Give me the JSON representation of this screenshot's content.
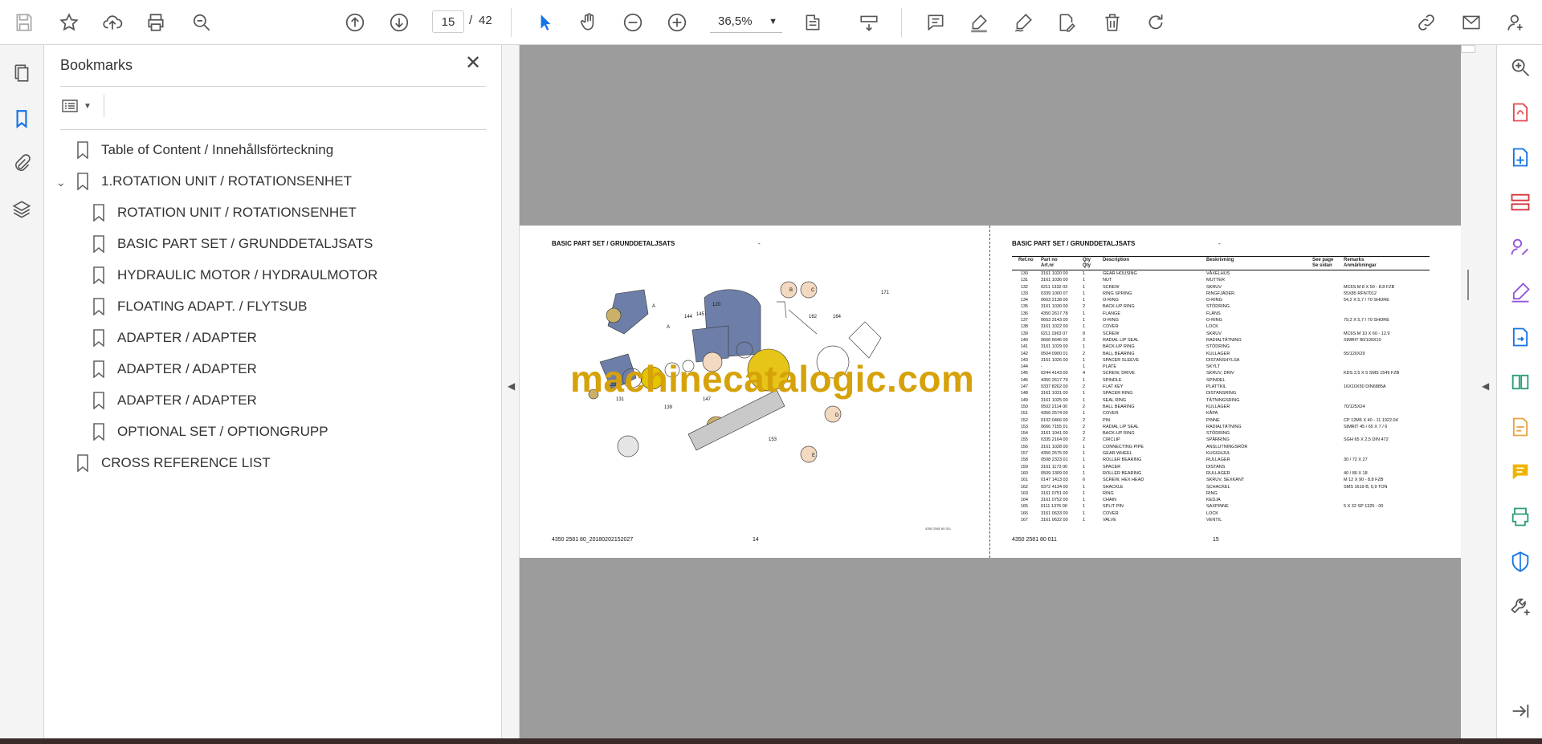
{
  "toolbar": {
    "page_current": "15",
    "page_separator": "/",
    "page_total": "42",
    "zoom": "36,5%"
  },
  "bookmarks": {
    "title": "Bookmarks",
    "items": [
      {
        "label": "Table of Content / Innehållsförteckning"
      },
      {
        "label": "1.ROTATION UNIT / ROTATIONSENHET"
      },
      {
        "label": "ROTATION UNIT / ROTATIONSENHET"
      },
      {
        "label": "BASIC PART SET / GRUNDDETALJSATS"
      },
      {
        "label": "HYDRAULIC MOTOR / HYDRAULMOTOR"
      },
      {
        "label": "FLOATING ADAPT. / FLYTSUB"
      },
      {
        "label": "ADAPTER / ADAPTER"
      },
      {
        "label": "ADAPTER / ADAPTER"
      },
      {
        "label": "ADAPTER / ADAPTER"
      },
      {
        "label": "OPTIONAL SET / OPTIONGRUPP"
      },
      {
        "label": "CROSS REFERENCE LIST"
      }
    ]
  },
  "document": {
    "left_page": {
      "header": "BASIC PART SET / GRUNDDETALJSATS",
      "header_dash": "-",
      "footer_doc": "4350 2581 80_20180202152027",
      "footer_page": "14",
      "drawing_code": "4350 2581 80 011"
    },
    "right_page": {
      "header": "BASIC PART SET / GRUNDDETALJSATS",
      "header_dash": "-",
      "footer_doc": "4350 2581 80 011",
      "footer_page": "15",
      "columns": {
        "ref": "Ref.no",
        "part": "Part no",
        "part2": "Art.nr",
        "qty": "Qty",
        "qty2": "Qty",
        "desc": "Description",
        "besk": "Beskrivning",
        "see": "See page",
        "see2": "Se sidan",
        "remarks": "Remarks",
        "remarks2": "Anmärkningar"
      },
      "rows": [
        [
          "130",
          "3161 1020 00",
          "1",
          "GEAR HOUSING",
          "VÄXELHUS",
          ""
        ],
        [
          "131",
          "3161 1036 00",
          "1",
          "NUT",
          "MUTTER",
          ""
        ],
        [
          "132",
          "0211 1332 03",
          "1",
          "SCREW",
          "SKRUV",
          "MC6S M 8 X 50 - 8.8 FZB"
        ],
        [
          "133",
          "0339 1000 07",
          "1",
          "RING SPRING",
          "RINGFJÄDER",
          "55X85 RFN7012"
        ],
        [
          "134",
          "0663 2138 00",
          "1",
          "O-RING",
          "O-RING",
          "54,2 X 5,7 / 70 SHORE"
        ],
        [
          "135",
          "3161 1030 00",
          "2",
          "BACK-UP RING",
          "STÖDRING",
          ""
        ],
        [
          "136",
          "4350 2617 78",
          "1",
          "FLANGE",
          "FLÄNS",
          ""
        ],
        [
          "137",
          "0663 3143 00",
          "1",
          "O-RING",
          "O-RING",
          "79,2 X 5,7 / 70 SHORE"
        ],
        [
          "138",
          "3161 1022 00",
          "1",
          "COVER",
          "LOCK",
          ""
        ],
        [
          "139",
          "0211 1963 07",
          "9",
          "SCREW",
          "SKRUV",
          "MC6S M 10 X 60 - 12.9"
        ],
        [
          "140",
          "0666 6646 00",
          "2",
          "RADIAL LIP SEAL",
          "RADIALTÄTNING",
          "SIMRIT 80/100X10"
        ],
        [
          "141",
          "3161 1029 00",
          "1",
          "BACK-UP RING",
          "STÖDRING",
          ""
        ],
        [
          "142",
          "0504 0900 01",
          "2",
          "BALL BEARING",
          "KULLAGER",
          "55/120X29"
        ],
        [
          "143",
          "3161 1026 00",
          "1",
          "SPACER SLEEVE",
          "DISTANSHYLSA",
          ""
        ],
        [
          "144",
          "-",
          "1",
          "PLATE",
          "SKYLT",
          ""
        ],
        [
          "145",
          "0244 4143 00",
          "4",
          "SCREW, DRIVE",
          "SKRUV, DRIV",
          "KDS 2,5 X 5 SMS 1549 FZB"
        ],
        [
          "146",
          "4350 2617 79",
          "1",
          "SPINDLE",
          "SPINDEL",
          ""
        ],
        [
          "147",
          "0337 8262 00",
          "2",
          "FLAT KEY",
          "PLATTKIL",
          "16X10X50 DIN6885A"
        ],
        [
          "148",
          "3161 1031 00",
          "1",
          "SPACER RING",
          "DISTANSRING",
          ""
        ],
        [
          "149",
          "3161 1025 00",
          "1",
          "SEAL RING",
          "TÄTNINGSRING",
          ""
        ],
        [
          "150",
          "0502 2114 00",
          "2",
          "BALL BEARING",
          "KULLAGER",
          "70/125X24"
        ],
        [
          "151",
          "4350 2574 00",
          "1",
          "COVER",
          "KÅPA",
          ""
        ],
        [
          "152",
          "0102 0466 00",
          "2",
          "PIN",
          "PINNE",
          "CP 12M6 X 40 - 11 1922.04"
        ],
        [
          "153",
          "0666 7155 01",
          "2",
          "RADIAL LIP SEAL",
          "RADIALTÄTNING",
          "SIMRIT 45 / 65 X 7 / 6"
        ],
        [
          "154",
          "3161 1041 00",
          "2",
          "BACK-UP RING",
          "STÖDRING",
          ""
        ],
        [
          "155",
          "0335 2164 00",
          "2",
          "CIRCLIP",
          "SPÅRRING",
          "SGH 65 X 2,5 DIN 472"
        ],
        [
          "156",
          "3161 1028 00",
          "1",
          "CONNECTING PIPE",
          "ANSLUTNINGSRÖR",
          ""
        ],
        [
          "157",
          "4350 2575 00",
          "1",
          "GEAR WHEEL",
          "KUGGHJUL",
          ""
        ],
        [
          "158",
          "0508 2323 01",
          "1",
          "ROLLER BEARING",
          "RULLAGER",
          "30 / 72 X 27"
        ],
        [
          "159",
          "3161 1173 00",
          "1",
          "SPACER",
          "DISTANS",
          ""
        ],
        [
          "160",
          "0509 1309 00",
          "1",
          "ROLLER BEARING",
          "RULLAGER",
          "40 / 80 X 18"
        ],
        [
          "161",
          "0147 1413 03",
          "6",
          "SCREW, HEX HEAD",
          "SKRUV, SEXKANT",
          "M 12 X 90 - 8.8 FZB"
        ],
        [
          "162",
          "0372 4134 00",
          "1",
          "SHACKLE",
          "SCHACKEL",
          "SMS 1619 B, 0,9 TON"
        ],
        [
          "163",
          "3161 0751 00",
          "1",
          "RING",
          "RING",
          ""
        ],
        [
          "164",
          "3161 0752 00",
          "1",
          "CHAIN",
          "KEDJA",
          ""
        ],
        [
          "165",
          "0111 1376 00",
          "1",
          "SPLIT PIN",
          "SAXPINNE",
          "5 X 32 SP 1325 - 00"
        ],
        [
          "166",
          "3161 0633 00",
          "1",
          "COVER",
          "LOCK",
          ""
        ],
        [
          "167",
          "3161 0632 00",
          "1",
          "VALVE",
          "VENTIL",
          ""
        ]
      ]
    },
    "watermark": "machinecatalogic.com"
  }
}
